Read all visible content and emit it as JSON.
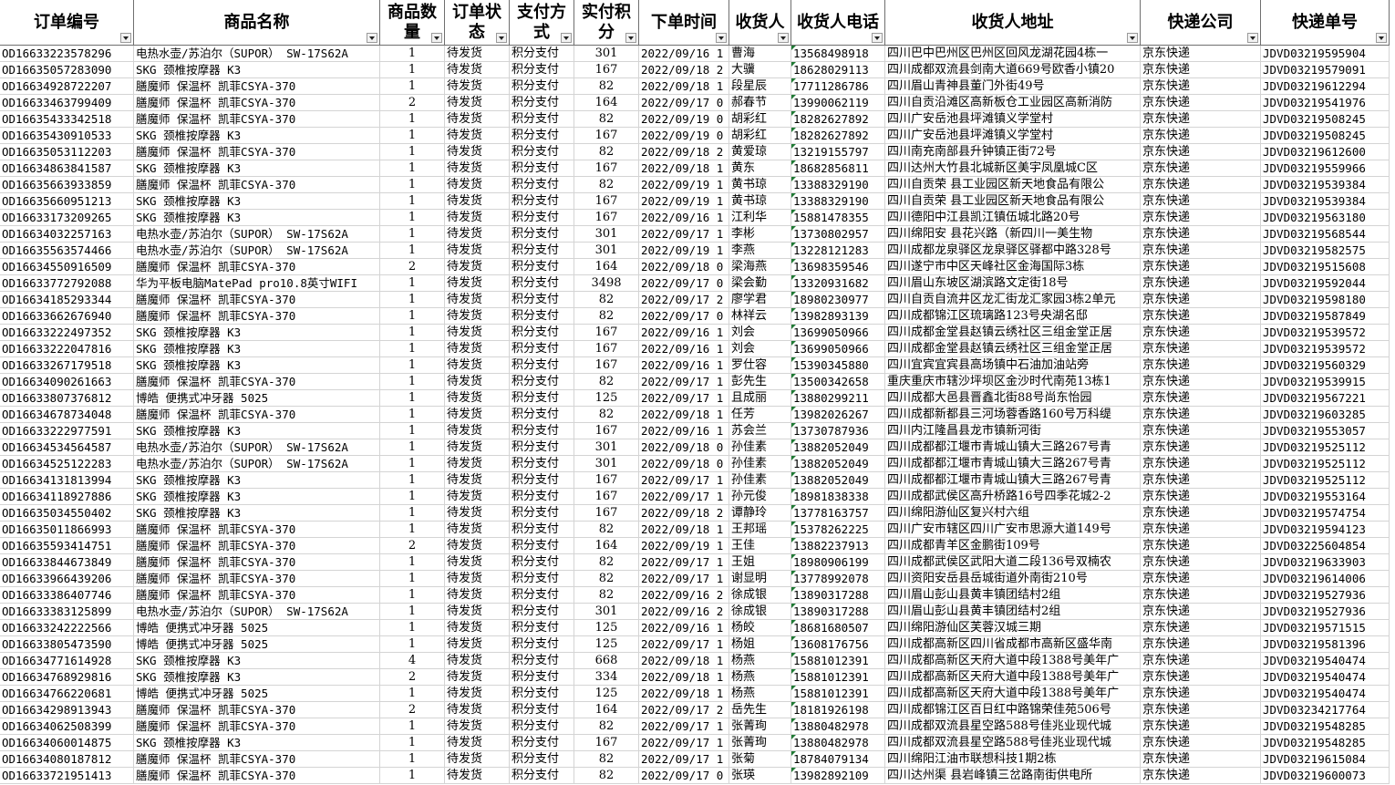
{
  "headers": [
    "订单编号",
    "商品名称",
    "商品数量",
    "订单状态",
    "支付方式",
    "实付积分",
    "下单时间",
    "收货人",
    "收货人电话",
    "收货人地址",
    "快递公司",
    "快递单号"
  ],
  "rows": [
    [
      "OD16633223578296",
      "电热水壶/苏泊尔（SUPOR） SW-17S62A",
      "1",
      "待发货",
      "积分支付",
      "301",
      "2022/09/16 1",
      "曹海",
      "13568498918",
      "四川巴中巴州区巴州区回风龙湖花园4栋一",
      "京东快递",
      "JDVD03219595904"
    ],
    [
      "OD16635057283090",
      "SKG 颈椎按摩器 K3",
      "1",
      "待发货",
      "积分支付",
      "167",
      "2022/09/18 2",
      "大骥",
      "18628029113",
      "四川成都双流县剑南大道669号欧香小镇20",
      "京东快递",
      "JDVD03219579091"
    ],
    [
      "OD16634928722207",
      "膳魔师 保温杯 凯菲CSYA-370",
      "1",
      "待发货",
      "积分支付",
      "82",
      "2022/09/18 1",
      "段星辰",
      "17711286786",
      "四川眉山青神县董门外街49号",
      "京东快递",
      "JDVD03219612294"
    ],
    [
      "OD16633463799409",
      "膳魔师 保温杯 凯菲CSYA-370",
      "2",
      "待发货",
      "积分支付",
      "164",
      "2022/09/17 0",
      "郝春节",
      "13990062119",
      "四川自贡沿滩区高新板仓工业园区高新消防",
      "京东快递",
      "JDVD03219541976"
    ],
    [
      "OD16635433342518",
      "膳魔师 保温杯 凯菲CSYA-370",
      "1",
      "待发货",
      "积分支付",
      "82",
      "2022/09/19 0",
      "胡彩红",
      "18282627892",
      "四川广安岳池县坪滩镇义学堂村",
      "京东快递",
      "JDVD03219508245"
    ],
    [
      "OD16635430910533",
      "SKG 颈椎按摩器 K3",
      "1",
      "待发货",
      "积分支付",
      "167",
      "2022/09/19 0",
      "胡彩红",
      "18282627892",
      "四川广安岳池县坪滩镇义学堂村",
      "京东快递",
      "JDVD03219508245"
    ],
    [
      "OD16635053112203",
      "膳魔师 保温杯 凯菲CSYA-370",
      "1",
      "待发货",
      "积分支付",
      "82",
      "2022/09/18 2",
      "黄爱琼",
      "13219155797",
      "四川南充南部县升钟镇正街72号",
      "京东快递",
      "JDVD03219612600"
    ],
    [
      "OD16634863841587",
      "SKG 颈椎按摩器 K3",
      "1",
      "待发货",
      "积分支付",
      "167",
      "2022/09/18 1",
      "黄东",
      "18682856811",
      "四川达州大竹县北城新区美宇凤凰城C区",
      "京东快递",
      "JDVD03219559966"
    ],
    [
      "OD16635663933859",
      "膳魔师 保温杯 凯菲CSYA-370",
      "1",
      "待发货",
      "积分支付",
      "82",
      "2022/09/19 1",
      "黄书琼",
      "13388329190",
      "四川自贡荣 县工业园区新天地食品有限公",
      "京东快递",
      "JDVD03219539384"
    ],
    [
      "OD16635660951213",
      "SKG 颈椎按摩器 K3",
      "1",
      "待发货",
      "积分支付",
      "167",
      "2022/09/19 1",
      "黄书琼",
      "13388329190",
      "四川自贡荣 县工业园区新天地食品有限公",
      "京东快递",
      "JDVD03219539384"
    ],
    [
      "OD16633173209265",
      "SKG 颈椎按摩器 K3",
      "1",
      "待发货",
      "积分支付",
      "167",
      "2022/09/16 1",
      "江利华",
      "15881478355",
      "四川德阳中江县凯江镇伍城北路20号",
      "京东快递",
      "JDVD03219563180"
    ],
    [
      "OD16634032257163",
      "电热水壶/苏泊尔（SUPOR） SW-17S62A",
      "1",
      "待发货",
      "积分支付",
      "301",
      "2022/09/17 1",
      "李彬",
      "13730802957",
      "四川绵阳安 县花兴路（新四川一美生物",
      "京东快递",
      "JDVD03219568544"
    ],
    [
      "OD16635563574466",
      "电热水壶/苏泊尔（SUPOR） SW-17S62A",
      "1",
      "待发货",
      "积分支付",
      "301",
      "2022/09/19 1",
      "李燕",
      "13228121283",
      "四川成都龙泉驿区龙泉驿区驿都中路328号",
      "京东快递",
      "JDVD03219582575"
    ],
    [
      "OD16634550916509",
      "膳魔师 保温杯 凯菲CSYA-370",
      "2",
      "待发货",
      "积分支付",
      "164",
      "2022/09/18 0",
      "梁海燕",
      "13698359546",
      "四川遂宁市中区天峰社区金海国际3栋",
      "京东快递",
      "JDVD03219515608"
    ],
    [
      "OD16633772792088",
      "华为平板电脑MatePad pro10.8英寸WIFI",
      "1",
      "待发货",
      "积分支付",
      "3498",
      "2022/09/17 0",
      "梁会勤",
      "13320931682",
      "四川眉山东坡区湖滨路文定街18号",
      "京东快递",
      "JDVD03219592044"
    ],
    [
      "OD16634185293344",
      "膳魔师 保温杯 凯菲CSYA-370",
      "1",
      "待发货",
      "积分支付",
      "82",
      "2022/09/17 2",
      "廖学君",
      "18980230977",
      "四川自贡自流井区龙汇街龙汇家园3栋2单元",
      "京东快递",
      "JDVD03219598180"
    ],
    [
      "OD16633662676940",
      "膳魔师 保温杯 凯菲CSYA-370",
      "1",
      "待发货",
      "积分支付",
      "82",
      "2022/09/17 0",
      "林祥云",
      "13982893139",
      "四川成都锦江区琉璃路123号央湖名邸",
      "京东快递",
      "JDVD03219587849"
    ],
    [
      "OD16633222497352",
      "SKG 颈椎按摩器 K3",
      "1",
      "待发货",
      "积分支付",
      "167",
      "2022/09/16 1",
      "刘会",
      "13699050966",
      "四川成都金堂县赵镇云绣社区三组金堂正居",
      "京东快递",
      "JDVD03219539572"
    ],
    [
      "OD16633222047816",
      "SKG 颈椎按摩器 K3",
      "1",
      "待发货",
      "积分支付",
      "167",
      "2022/09/16 1",
      "刘会",
      "13699050966",
      "四川成都金堂县赵镇云绣社区三组金堂正居",
      "京东快递",
      "JDVD03219539572"
    ],
    [
      "OD16633267179518",
      "SKG 颈椎按摩器 K3",
      "1",
      "待发货",
      "积分支付",
      "167",
      "2022/09/16 1",
      "罗仕容",
      "15390345880",
      "四川宜宾宜宾县高场镇中石油加油站旁",
      "京东快递",
      "JDVD03219560329"
    ],
    [
      "OD16634090261663",
      "膳魔师 保温杯 凯菲CSYA-370",
      "1",
      "待发货",
      "积分支付",
      "82",
      "2022/09/17 1",
      "彭先生",
      "13500342658",
      "重庆重庆市辖沙坪坝区金沙时代南苑13栋1",
      "京东快递",
      "JDVD03219539915"
    ],
    [
      "OD16633807376812",
      "博皓 便携式冲牙器 5025",
      "1",
      "待发货",
      "积分支付",
      "125",
      "2022/09/17 1",
      "且成丽",
      "13880299211",
      "四川成都大邑县晋鑫北街88号尚东怡园",
      "京东快递",
      "JDVD03219567221"
    ],
    [
      "OD16634678734048",
      "膳魔师 保温杯 凯菲CSYA-370",
      "1",
      "待发货",
      "积分支付",
      "82",
      "2022/09/18 1",
      "任芳",
      "13982026267",
      "四川成都新都县三河场蓉香路160号万科缇",
      "京东快递",
      "JDVD03219603285"
    ],
    [
      "OD16633222977591",
      "SKG 颈椎按摩器 K3",
      "1",
      "待发货",
      "积分支付",
      "167",
      "2022/09/16 1",
      "苏会兰",
      "13730787936",
      "四川内江隆昌县龙市镇新河街",
      "京东快递",
      "JDVD03219553057"
    ],
    [
      "OD16634534564587",
      "电热水壶/苏泊尔（SUPOR） SW-17S62A",
      "1",
      "待发货",
      "积分支付",
      "301",
      "2022/09/18 0",
      "孙佳素",
      "13882052049",
      "四川成都都江堰市青城山镇大三路267号青",
      "京东快递",
      "JDVD03219525112"
    ],
    [
      "OD16634525122283",
      "电热水壶/苏泊尔（SUPOR） SW-17S62A",
      "1",
      "待发货",
      "积分支付",
      "301",
      "2022/09/18 0",
      "孙佳素",
      "13882052049",
      "四川成都都江堰市青城山镇大三路267号青",
      "京东快递",
      "JDVD03219525112"
    ],
    [
      "OD16634131813994",
      "SKG 颈椎按摩器 K3",
      "1",
      "待发货",
      "积分支付",
      "167",
      "2022/09/17 1",
      "孙佳素",
      "13882052049",
      "四川成都都江堰市青城山镇大三路267号青",
      "京东快递",
      "JDVD03219525112"
    ],
    [
      "OD16634118927886",
      "SKG 颈椎按摩器 K3",
      "1",
      "待发货",
      "积分支付",
      "167",
      "2022/09/17 1",
      "孙元俊",
      "18981838338",
      "四川成都武侯区高升桥路16号四季花城2-2",
      "京东快递",
      "JDVD03219553164"
    ],
    [
      "OD16635034550402",
      "SKG 颈椎按摩器 K3",
      "1",
      "待发货",
      "积分支付",
      "167",
      "2022/09/18 2",
      "谭静玲",
      "13778163757",
      "四川绵阳游仙区复兴村六组",
      "京东快递",
      "JDVD03219574754"
    ],
    [
      "OD16635011866993",
      "膳魔师 保温杯 凯菲CSYA-370",
      "1",
      "待发货",
      "积分支付",
      "82",
      "2022/09/18 1",
      "王邦瑶",
      "15378262225",
      "四川广安市辖区四川广安市思源大道149号",
      "京东快递",
      "JDVD03219594123"
    ],
    [
      "OD16635593414751",
      "膳魔师 保温杯 凯菲CSYA-370",
      "2",
      "待发货",
      "积分支付",
      "164",
      "2022/09/19 1",
      "王佳",
      "13882237913",
      "四川成都青羊区金鹏街109号",
      "京东快递",
      "JDVD03225604854"
    ],
    [
      "OD16633844673849",
      "膳魔师 保温杯 凯菲CSYA-370",
      "1",
      "待发货",
      "积分支付",
      "82",
      "2022/09/17 1",
      "王姐",
      "18980906199",
      "四川成都武侯区武阳大道二段136号双楠农",
      "京东快递",
      "JDVD03219633903"
    ],
    [
      "OD16633966439206",
      "膳魔师 保温杯 凯菲CSYA-370",
      "1",
      "待发货",
      "积分支付",
      "82",
      "2022/09/17 1",
      "谢显明",
      "13778992078",
      "四川资阳安岳县岳城街道外南街210号",
      "京东快递",
      "JDVD03219614006"
    ],
    [
      "OD16633386407746",
      "膳魔师 保温杯 凯菲CSYA-370",
      "1",
      "待发货",
      "积分支付",
      "82",
      "2022/09/16 2",
      "徐成银",
      "13890317288",
      "四川眉山彭山县黄丰镇团结村2组",
      "京东快递",
      "JDVD03219527936"
    ],
    [
      "OD16633383125899",
      "电热水壶/苏泊尔（SUPOR） SW-17S62A",
      "1",
      "待发货",
      "积分支付",
      "301",
      "2022/09/16 2",
      "徐成银",
      "13890317288",
      "四川眉山彭山县黄丰镇团结村2组",
      "京东快递",
      "JDVD03219527936"
    ],
    [
      "OD16633242222566",
      "博皓 便携式冲牙器 5025",
      "1",
      "待发货",
      "积分支付",
      "125",
      "2022/09/16 1",
      "杨皎",
      "18681680507",
      "四川绵阳游仙区芙蓉汉城三期",
      "京东快递",
      "JDVD03219571515"
    ],
    [
      "OD16633805473590",
      "博皓 便携式冲牙器 5025",
      "1",
      "待发货",
      "积分支付",
      "125",
      "2022/09/17 1",
      "杨姐",
      "13608176756",
      "四川成都高新区四川省成都市高新区盛华南",
      "京东快递",
      "JDVD03219581396"
    ],
    [
      "OD16634771614928",
      "SKG 颈椎按摩器 K3",
      "4",
      "待发货",
      "积分支付",
      "668",
      "2022/09/18 1",
      "杨燕",
      "15881012391",
      "四川成都高新区天府大道中段1388号美年广",
      "京东快递",
      "JDVD03219540474"
    ],
    [
      "OD16634768929816",
      "SKG 颈椎按摩器 K3",
      "2",
      "待发货",
      "积分支付",
      "334",
      "2022/09/18 1",
      "杨燕",
      "15881012391",
      "四川成都高新区天府大道中段1388号美年广",
      "京东快递",
      "JDVD03219540474"
    ],
    [
      "OD16634766220681",
      "博皓 便携式冲牙器 5025",
      "1",
      "待发货",
      "积分支付",
      "125",
      "2022/09/18 1",
      "杨燕",
      "15881012391",
      "四川成都高新区天府大道中段1388号美年广",
      "京东快递",
      "JDVD03219540474"
    ],
    [
      "OD16634298913943",
      "膳魔师 保温杯 凯菲CSYA-370",
      "2",
      "待发货",
      "积分支付",
      "164",
      "2022/09/17 2",
      "岳先生",
      "18181926198",
      "四川成都锦江区百日红中路锦荣佳苑506号",
      "京东快递",
      "JDVD03234217764"
    ],
    [
      "OD16634062508399",
      "膳魔师 保温杯 凯菲CSYA-370",
      "1",
      "待发货",
      "积分支付",
      "82",
      "2022/09/17 1",
      "张菁珣",
      "13880482978",
      "四川成都双流县星空路588号佳兆业现代城",
      "京东快递",
      "JDVD03219548285"
    ],
    [
      "OD16634060014875",
      "SKG 颈椎按摩器 K3",
      "1",
      "待发货",
      "积分支付",
      "167",
      "2022/09/17 1",
      "张菁珣",
      "13880482978",
      "四川成都双流县星空路588号佳兆业现代城",
      "京东快递",
      "JDVD03219548285"
    ],
    [
      "OD16634080187812",
      "膳魔师 保温杯 凯菲CSYA-370",
      "1",
      "待发货",
      "积分支付",
      "82",
      "2022/09/17 1",
      "张菊",
      "18784079134",
      "四川绵阳江油市联想科技1期2栋",
      "京东快递",
      "JDVD03219615084"
    ],
    [
      "OD16633721951413",
      "膳魔师 保温杯 凯菲CSYA-370",
      "1",
      "待发货",
      "积分支付",
      "82",
      "2022/09/17 0",
      "张瑛",
      "13982892109",
      "四川达州渠 县岩峰镇三岔路南街供电所",
      "京东快递",
      "JDVD03219600073"
    ]
  ]
}
